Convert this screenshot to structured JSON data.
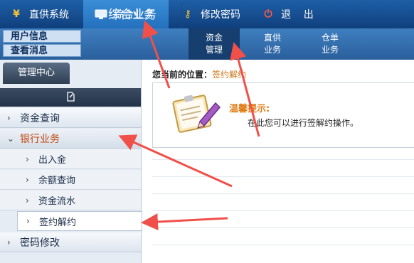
{
  "top_nav": {
    "items": [
      {
        "icon": "yen-icon",
        "glyph": "¥",
        "label": "直供系统"
      },
      {
        "icon": "monitor-icon",
        "glyph": "▭",
        "label": "综合业务",
        "active": true
      },
      {
        "icon": "key-icon",
        "glyph": "⚷",
        "label": "修改密码"
      },
      {
        "icon": "power-icon",
        "glyph": "⏻",
        "label": "退    出"
      }
    ]
  },
  "sub_bar": {
    "user_info": "用户信息",
    "view_messages": "查看消息",
    "title": "综合业务",
    "tabs": [
      {
        "line1": "资金",
        "line2": "管理",
        "active": true
      },
      {
        "line1": "直供",
        "line2": "业务"
      },
      {
        "line1": "仓单",
        "line2": "业务"
      }
    ]
  },
  "sidebar": {
    "tab_label": "管理中心",
    "tool_icon": "file-edit-icon",
    "items": [
      {
        "label": "资金查询",
        "level": 1,
        "expanded": false
      },
      {
        "label": "银行业务",
        "level": 1,
        "expanded": true
      },
      {
        "label": "出入金",
        "level": 2
      },
      {
        "label": "余额查询",
        "level": 2
      },
      {
        "label": "资金流水",
        "level": 2
      },
      {
        "label": "签约解约",
        "level": 2,
        "selected": true
      },
      {
        "label": "密码修改",
        "level": 1,
        "expanded": false
      }
    ]
  },
  "main": {
    "breadcrumb_prefix": "您当前的位置：",
    "breadcrumb_current": "签约解约",
    "tip_title": "温馨提示:",
    "tip_text": "在此您可以进行签解约操作。"
  },
  "colors": {
    "annotation_arrow": "#f0504a",
    "accent_orange": "#e07a12",
    "nav_blue": "#1f5fa6"
  }
}
